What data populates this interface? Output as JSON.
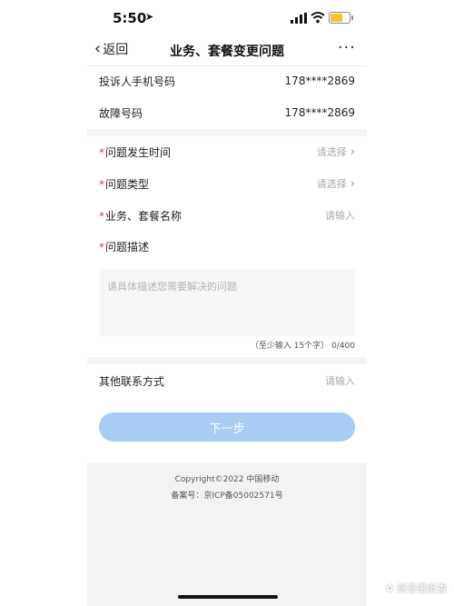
{
  "status": {
    "time": "5:50",
    "location_icon": "location-arrow-icon",
    "signal_icon": "signal-bars-icon",
    "wifi_icon": "wifi-icon",
    "battery_icon": "battery-icon",
    "battery_color": "#f2c230"
  },
  "nav": {
    "back_label": "返回",
    "title": "业务、套餐变更问题",
    "more_label": "···"
  },
  "info": {
    "complaint_phone_label": "投诉人手机号码",
    "complaint_phone_value": "178****2869",
    "fault_number_label": "故障号码",
    "fault_number_value": "178****2869"
  },
  "form": {
    "required_mark": "*",
    "time_label": "问题发生时间",
    "time_placeholder": "请选择",
    "type_label": "问题类型",
    "type_placeholder": "请选择",
    "business_label": "业务、套餐名称",
    "business_placeholder": "请输入",
    "desc_label": "问题描述",
    "desc_placeholder": "请具体描述您需要解决的问题",
    "counter_hint": "（至少输入 15个字）",
    "counter_value": "0/400",
    "contact_label": "其他联系方式",
    "contact_placeholder": "请输入"
  },
  "next_button": {
    "label": "下一步",
    "color": "#a7cdf2"
  },
  "footer": {
    "copyright": "Copyright©2022 中国移动",
    "icp": "备案号：京ICP备05002571号"
  },
  "watermark": {
    "text": "纸卷墨纸香"
  },
  "colors": {
    "required": "#e53935",
    "section_gap": "#f4f5f7",
    "footer_bg": "#f2f3f5"
  }
}
